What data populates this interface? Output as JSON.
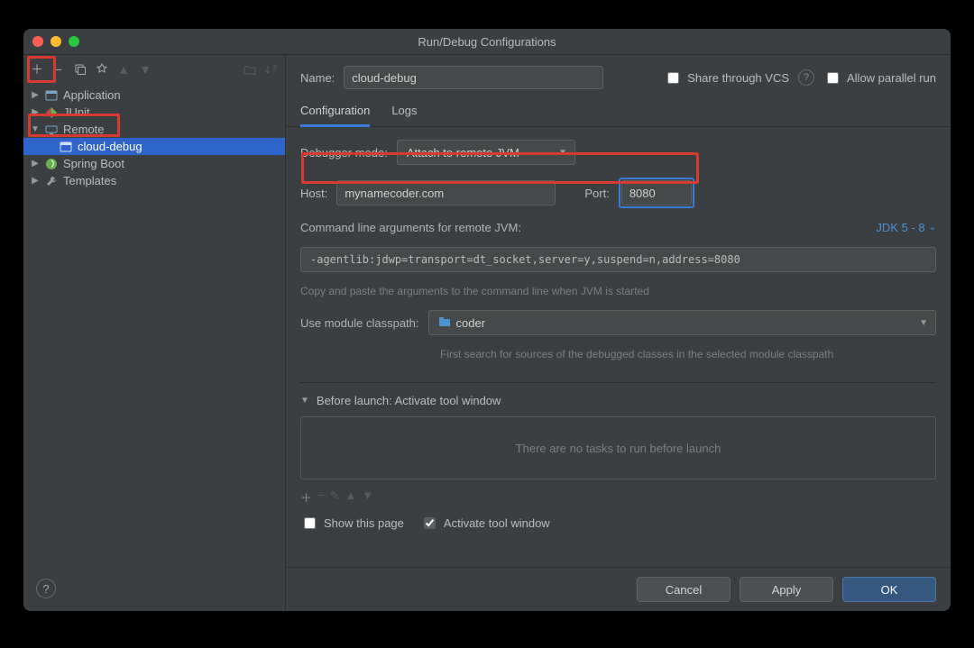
{
  "window": {
    "title": "Run/Debug Configurations"
  },
  "sidebar": {
    "items": [
      {
        "label": "Application"
      },
      {
        "label": "JUnit"
      },
      {
        "label": "Remote",
        "expanded": true,
        "children": [
          {
            "label": "cloud-debug"
          }
        ]
      },
      {
        "label": "Spring Boot"
      },
      {
        "label": "Templates"
      }
    ]
  },
  "name_row": {
    "label": "Name:",
    "value": "cloud-debug",
    "share_label": "Share through VCS",
    "parallel_label": "Allow parallel run"
  },
  "tabs": {
    "config": "Configuration",
    "logs": "Logs"
  },
  "debugger_mode": {
    "label": "Debugger mode:",
    "value": "Attach to remote JVM"
  },
  "host": {
    "label": "Host:",
    "value": "mynamecoder.com"
  },
  "port": {
    "label": "Port:",
    "value": "8080"
  },
  "cmd_args": {
    "label": "Command line arguments for remote JVM:",
    "value": "-agentlib:jdwp=transport=dt_socket,server=y,suspend=n,address=8080",
    "hint": "Copy and paste the arguments to the command line when JVM is started",
    "jdk_label": "JDK 5 - 8"
  },
  "module": {
    "label": "Use module classpath:",
    "value": "coder",
    "hint": "First search for sources of the debugged classes in the selected module classpath"
  },
  "before_launch": {
    "header": "Before launch: Activate tool window",
    "empty": "There are no tasks to run before launch",
    "show_page": "Show this page",
    "activate": "Activate tool window"
  },
  "buttons": {
    "cancel": "Cancel",
    "apply": "Apply",
    "ok": "OK"
  }
}
